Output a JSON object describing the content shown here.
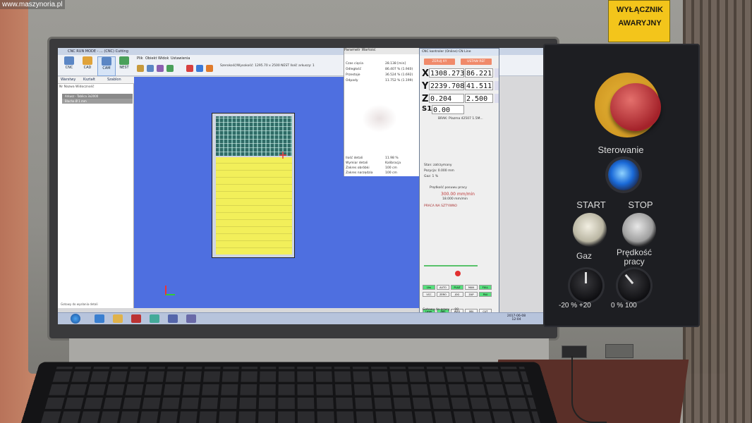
{
  "watermark": "www.maszynoria.pl",
  "app": {
    "title": "CNC RUN MODE - ... (CNC) Cutting",
    "ribbon": [
      "CNC",
      "CAD",
      "CAM",
      "NEST"
    ],
    "menu": [
      "Plik",
      "Obiekt",
      "Widok",
      "Ustawienia"
    ],
    "info": "Szerokość/Wysokość: 1295.70 x 2500  NEST   Ilość arkuszy: 1"
  },
  "left_panel": {
    "tabs": [
      "Warstwy",
      "Kształt",
      "Szablon"
    ],
    "header": "Nr   Nazwa   Widoczność",
    "rows": [
      "Arkusz - Tablica 3x2000",
      "Blacha Ø 1 mm"
    ],
    "footer": "Gotowy do wysłania detali"
  },
  "props": {
    "header": "Parametr            Wartość",
    "rows": [
      [
        "Czas cięcia",
        "28.138 [min]"
      ],
      [
        "Odległość",
        "86.407 % (1.940)"
      ],
      [
        "Przestoje",
        "36.524 % (1.692)"
      ],
      [
        "Odpady",
        "11.752 % (1.199)"
      ]
    ],
    "lower": [
      [
        "Ilość detali",
        "11.98 %"
      ],
      [
        "Wymiar detali",
        "Kalibracja"
      ],
      [
        "Zakres obróbki",
        "100 cm"
      ],
      [
        "Zakres narzędzia",
        "100 cm"
      ]
    ]
  },
  "cnc": {
    "title": "CNC kontroler (Online) CN Line",
    "btn_left": "ZERUJ XY",
    "btn_right": "USTAW REF",
    "axes": [
      {
        "axis": "X",
        "v1": "1308.273",
        "v2": "86.221"
      },
      {
        "axis": "Y",
        "v1": "2239.708",
        "v2": "41.511"
      },
      {
        "axis": "Z",
        "v1": "0.204",
        "v2": "2.500"
      },
      {
        "axis": "S1",
        "v1": "0.00",
        "v2": ""
      }
    ],
    "job": "BRAK: Plazma 42507 1.5M...",
    "speed_label": "Prędkość posuwu pracy",
    "speed_value": "300.00 mm/min",
    "speed_sub": "18.000 mm/min",
    "mode": "PRACA NA SZTYWNO",
    "status_lines": [
      "Stan: zatrzymany",
      "Pozycja: 0.000 mm",
      "Gaz: 1 %"
    ],
    "buttons": [
      [
        "Lhs",
        "AUTO",
        "PLAZ",
        "MAN",
        "FULL"
      ],
      [
        "VCC",
        "ZERO",
        "JOG",
        "ZAP",
        "PAU"
      ],
      [
        "Laser",
        "ABS",
        "WZG",
        "MN",
        "CUT"
      ]
    ],
    "footer": "Gotowy do pracy ... 00"
  },
  "taskbar": {
    "clock": "2017-06-08 12:04"
  },
  "panel": {
    "sign_line1": "WYŁĄCZNIK",
    "sign_line2": "AWARYJNY",
    "sterowanie": "Sterowanie",
    "start": "START",
    "stop": "STOP",
    "gaz": "Gaz",
    "predkosc_line1": "Prędkość",
    "predkosc_line2": "pracy",
    "gaz_scale": "-20  %  +20",
    "speed_scale": "0  %  100"
  }
}
